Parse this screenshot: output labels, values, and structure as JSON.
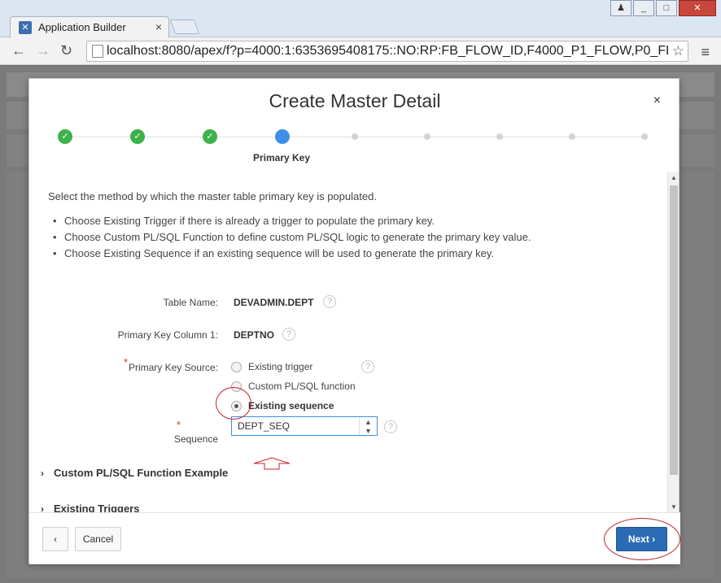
{
  "browser": {
    "tab_title": "Application Builder",
    "tab_close": "×",
    "url": "localhost:8080/apex/f?p=4000:1:6353695408175::NO:RP:FB_FLOW_ID,F4000_P1_FLOW,P0_FLOWPA",
    "star": "☆",
    "menu": "≡",
    "back": "←",
    "forward": "→",
    "reload": "↻",
    "win_min": "_",
    "win_max": "□",
    "win_close": "✕",
    "win_user": "♟"
  },
  "dialog": {
    "title": "Create Master Detail",
    "close": "×",
    "steps": {
      "current_label": "Primary Key",
      "states": [
        "done",
        "done",
        "done",
        "current",
        "future",
        "future",
        "future",
        "future",
        "future"
      ],
      "check": "✓"
    },
    "intro": "Select the method by which the master table primary key is populated.",
    "bullets": [
      "Choose Existing Trigger if there is already a trigger to populate the primary key.",
      "Choose Custom PL/SQL Function to define custom PL/SQL logic to generate the primary key value.",
      "Choose Existing Sequence if an existing sequence will be used to generate the primary key."
    ],
    "form": {
      "table_name_label": "Table Name:",
      "table_name_value": "DEVADMIN.DEPT",
      "pk_col_label": "Primary Key Column 1:",
      "pk_col_value": "DEPTNO",
      "pk_source_label": "Primary Key Source:",
      "pk_source_options": [
        "Existing trigger",
        "Custom PL/SQL function",
        "Existing sequence"
      ],
      "pk_source_selected": "Existing sequence",
      "sequence_label": "Sequence",
      "sequence_value": "DEPT_SEQ",
      "required_mark": "*",
      "help": "?"
    },
    "regions": {
      "custom_plsql": "Custom PL/SQL Function Example",
      "existing_triggers": "Existing Triggers",
      "chevron": "›"
    },
    "buttons": {
      "prev": "‹",
      "cancel": "Cancel",
      "next": "Next",
      "next_chevron": "›"
    }
  },
  "colors": {
    "step_done": "#3bb24a",
    "step_current": "#3d8ee6",
    "primary_button": "#2a6bb4",
    "annotation": "#c0262d"
  }
}
